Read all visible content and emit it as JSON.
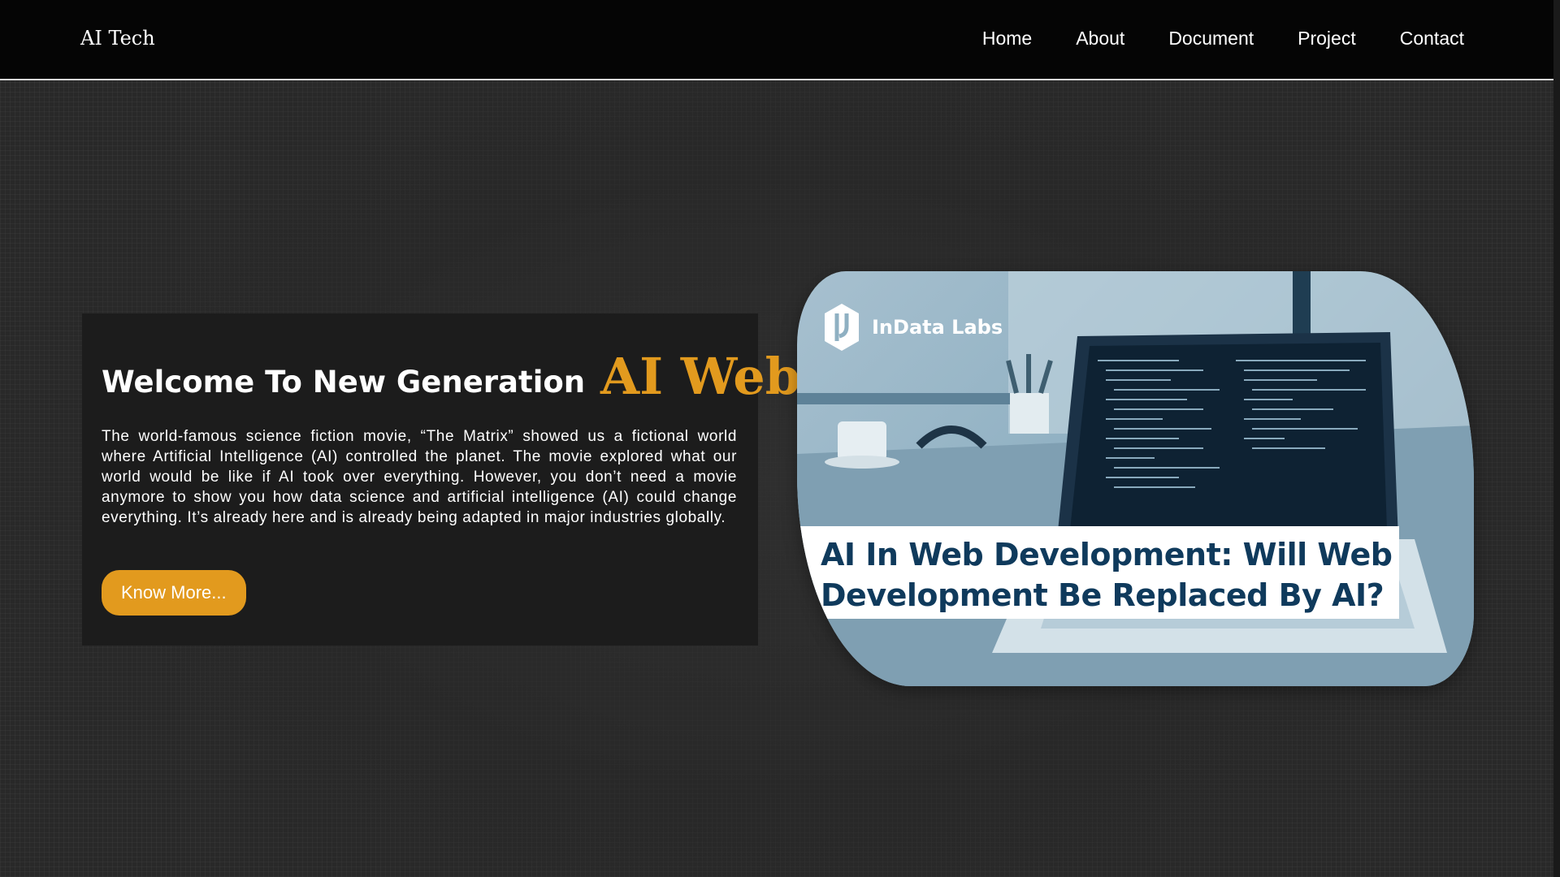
{
  "navbar": {
    "brand": "AI Tech",
    "links": [
      "Home",
      "About",
      "Document",
      "Project",
      "Contact"
    ]
  },
  "hero": {
    "heading": "Welcome To New Generation",
    "heading_accent": "AI Web",
    "paragraph": "The world-famous science fiction movie, “The Matrix” showed us a fictional world where Artificial Intelligence (AI) controlled the planet. The movie explored what our world would be like if AI took over everything. However, you don’t need a movie anymore to show you how data science and artificial intelligence (AI) could change everything. It’s already here and is already being adapted in major industries globally.",
    "button_label": "Know More..."
  },
  "image": {
    "logo_text": "InData Labs",
    "banner_line1": "AI In Web Development: Will Web",
    "banner_line2": "Development Be Replaced By AI?"
  },
  "colors": {
    "accent": "#e29a1e",
    "navbar_bg": "#050505",
    "card_bg": "#1c1c1c",
    "banner_text": "#0f3a5c"
  },
  "icons": {
    "logo": "indata-labs-logo-icon"
  }
}
